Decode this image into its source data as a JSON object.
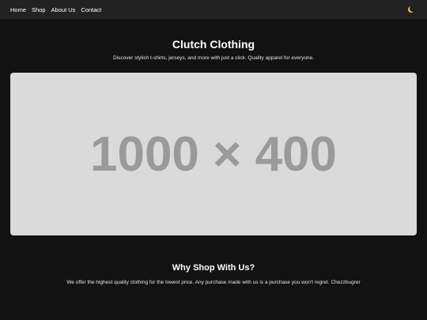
{
  "nav": {
    "links": [
      "Home",
      "Shop",
      "About Us",
      "Contact"
    ],
    "theme_icon": "moon-icon"
  },
  "hero": {
    "title": "Clutch Clothing",
    "subtitle": "Discover stylish t-shirts, jerseys, and more with just a click. Quality apparel for everyone."
  },
  "banner": {
    "placeholder_text": "1000 × 400"
  },
  "why": {
    "title": "Why Shop With Us?",
    "text": "We offer the highest quality clothing for the lowest price. Any purchase made with us is a purchase you won't regret. Chezzbugrer"
  },
  "colors": {
    "background": "#121212",
    "navbar": "#222222",
    "banner": "#dadada",
    "banner_text": "#9a9a9a",
    "moon": "#f2c230"
  }
}
